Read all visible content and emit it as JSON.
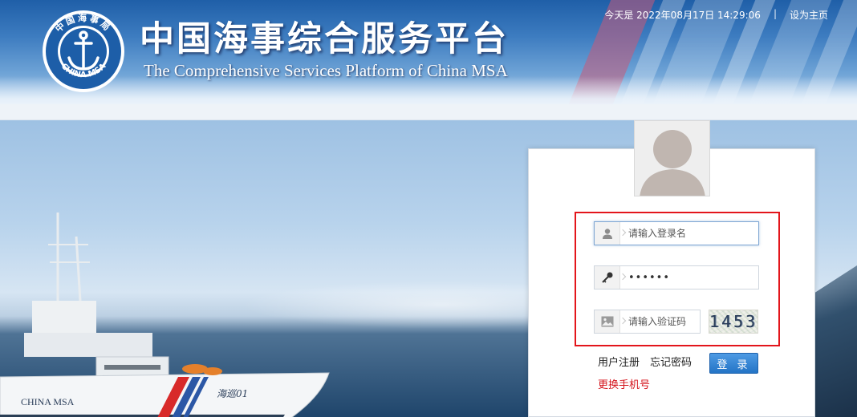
{
  "header": {
    "title": "中国海事综合服务平台",
    "subtitle": "The Comprehensive Services Platform of China MSA",
    "logo": {
      "ring_text_top": "中国海事局",
      "ring_text_bottom": "CHINA MSA"
    },
    "date_text": "今天是 2022年08月17日 14:29:06",
    "separator": "|",
    "set_homepage": "设为主页"
  },
  "hero": {
    "ship_hull_text": "CHINA MSA",
    "ship_bow_text": "海巡01"
  },
  "login": {
    "username_placeholder": "请输入登录名",
    "password_value": "••••••",
    "captcha_placeholder": "请输入验证码",
    "captcha_code": "1453",
    "register": "用户注册",
    "forgot_password": "忘记密码",
    "login_button": "登 录",
    "change_phone": "更换手机号"
  },
  "colors": {
    "highlight_border": "#e3151b",
    "login_button": "#2f80d0",
    "change_phone_link": "#d4121a"
  },
  "icons": {
    "username": "user-icon",
    "password": "key-icon",
    "captcha": "image-icon"
  }
}
